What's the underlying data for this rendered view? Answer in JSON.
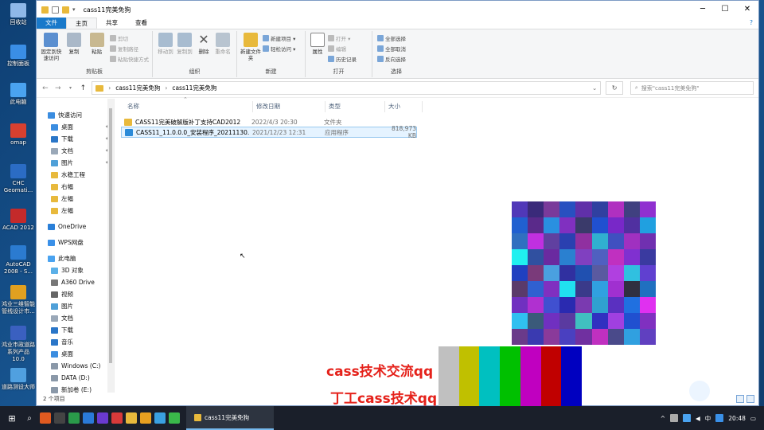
{
  "desktop": {
    "icons": [
      {
        "label": "回收站",
        "icon": "recycle-bin-icon",
        "color": "#8fb8e8"
      },
      {
        "label": "控制面板",
        "icon": "control-panel-icon",
        "color": "#3a8ee6"
      },
      {
        "label": "此电脑",
        "icon": "computer-icon",
        "color": "#4aa3f0"
      },
      {
        "label": "omap",
        "icon": "omap-icon",
        "color": "#d84030"
      },
      {
        "label": "CHC Geomati...",
        "icon": "chc-icon",
        "color": "#2b6cc4"
      },
      {
        "label": "ACAD 2012",
        "icon": "acad-icon",
        "color": "#c42a2a"
      },
      {
        "label": "AutoCAD 2008 - S...",
        "icon": "autocad-icon",
        "color": "#2b7bd0"
      },
      {
        "label": "鸿业三维智能管线设计市...",
        "icon": "hongye-pipe-icon",
        "color": "#e0a020"
      },
      {
        "label": "鸿业市政道路系列产品10.0",
        "icon": "hongye-road-icon",
        "color": "#3a60c0"
      },
      {
        "label": "道路测设大师",
        "icon": "road-survey-icon",
        "color": "#50a0e0"
      }
    ]
  },
  "window": {
    "title": "cass11完美免狗",
    "controls": {
      "minimize": "─",
      "maximize": "☐",
      "close": "✕"
    }
  },
  "ribbon_tabs": [
    "文件",
    "主页",
    "共享",
    "查看"
  ],
  "ribbon": {
    "clipboard": {
      "pin": "固定到快速访问",
      "copy": "复制",
      "paste": "粘贴",
      "cut": "剪切",
      "copy_path": "复制路径",
      "paste_shortcut": "粘贴快捷方式",
      "label": "剪贴板"
    },
    "organize": {
      "move_to": "移动到",
      "copy_to": "复制到",
      "delete": "删除",
      "rename": "重命名",
      "label": "组织"
    },
    "new": {
      "new_folder": "新建文件夹",
      "new_item": "新建项目 ▾",
      "easy_access": "轻松访问 ▾",
      "label": "新建"
    },
    "open": {
      "properties": "属性",
      "open": "打开 ▾",
      "edit": "编辑",
      "history": "历史记录",
      "label": "打开"
    },
    "select": {
      "select_all": "全部选择",
      "select_none": "全部取消",
      "invert": "反向选择",
      "label": "选择"
    }
  },
  "address": {
    "path": [
      "cass11完美免狗",
      "cass11完美免狗"
    ],
    "search_placeholder": "搜索\"cass11完美免狗\""
  },
  "sidebar": {
    "items": [
      {
        "label": "快速访问",
        "icon": "star-icon",
        "color": "#3b8de0",
        "pinned": false,
        "indent": 1
      },
      {
        "label": "桌面",
        "icon": "desktop-folder-icon",
        "color": "#3b8de0",
        "pinned": true,
        "indent": 2
      },
      {
        "label": "下载",
        "icon": "download-icon",
        "color": "#2a76c8",
        "pinned": true,
        "indent": 2
      },
      {
        "label": "文档",
        "icon": "documents-icon",
        "color": "#9aa8b8",
        "pinned": true,
        "indent": 2
      },
      {
        "label": "图片",
        "icon": "pictures-icon",
        "color": "#4fa0d8",
        "pinned": true,
        "indent": 2
      },
      {
        "label": "水稳工程",
        "icon": "folder-icon",
        "color": "#e8b93c",
        "pinned": false,
        "indent": 2
      },
      {
        "label": "右幅",
        "icon": "folder-icon",
        "color": "#e8b93c",
        "pinned": false,
        "indent": 2
      },
      {
        "label": "左幅",
        "icon": "folder-icon",
        "color": "#e8b93c",
        "pinned": false,
        "indent": 2
      },
      {
        "label": "左幅",
        "icon": "folder-icon",
        "color": "#e8b93c",
        "pinned": false,
        "indent": 2
      },
      {
        "label": "",
        "icon": "",
        "color": "",
        "pinned": false,
        "indent": 0
      },
      {
        "label": "OneDrive",
        "icon": "cloud-icon",
        "color": "#2a7fd8",
        "pinned": false,
        "indent": 1
      },
      {
        "label": "",
        "icon": "",
        "color": "",
        "pinned": false,
        "indent": 0
      },
      {
        "label": "WPS网盘",
        "icon": "wps-cloud-icon",
        "color": "#3a90e8",
        "pinned": false,
        "indent": 1
      },
      {
        "label": "",
        "icon": "",
        "color": "",
        "pinned": false,
        "indent": 0
      },
      {
        "label": "此电脑",
        "icon": "computer-icon",
        "color": "#4aa3f0",
        "pinned": false,
        "indent": 1
      },
      {
        "label": "3D 对象",
        "icon": "3d-objects-icon",
        "color": "#5bb0e8",
        "pinned": false,
        "indent": 2
      },
      {
        "label": "A360 Drive",
        "icon": "a360-icon",
        "color": "#777777",
        "pinned": false,
        "indent": 2
      },
      {
        "label": "视频",
        "icon": "video-icon",
        "color": "#666666",
        "pinned": false,
        "indent": 2
      },
      {
        "label": "图片",
        "icon": "pictures-icon",
        "color": "#4fa0d8",
        "pinned": false,
        "indent": 2
      },
      {
        "label": "文档",
        "icon": "documents-icon",
        "color": "#9aa8b8",
        "pinned": false,
        "indent": 2
      },
      {
        "label": "下载",
        "icon": "download-icon",
        "color": "#2a76c8",
        "pinned": false,
        "indent": 2
      },
      {
        "label": "音乐",
        "icon": "music-icon",
        "color": "#2a76c8",
        "pinned": false,
        "indent": 2
      },
      {
        "label": "桌面",
        "icon": "desktop-folder-icon",
        "color": "#3b8de0",
        "pinned": false,
        "indent": 2
      },
      {
        "label": "Windows (C:)",
        "icon": "drive-icon",
        "color": "#8a98a8",
        "pinned": false,
        "indent": 2
      },
      {
        "label": "DATA (D:)",
        "icon": "drive-icon",
        "color": "#8a98a8",
        "pinned": false,
        "indent": 2
      },
      {
        "label": "新加卷 (E:)",
        "icon": "drive-icon",
        "color": "#8a98a8",
        "pinned": false,
        "indent": 2
      }
    ]
  },
  "columns": [
    "名称",
    "修改日期",
    "类型",
    "大小"
  ],
  "files": [
    {
      "name": "CASS11完美破解版补丁支持CAD2012",
      "date": "2022/4/3 20:30",
      "type": "文件夹",
      "size": "",
      "icon": "folder-icon",
      "color": "#e8b93c",
      "selected": false
    },
    {
      "name": "CASS11_11.0.0.0_安装程序_20211130...",
      "date": "2021/12/23 12:31",
      "type": "应用程序",
      "size": "818,973 KB",
      "icon": "installer-icon",
      "color": "#2a8ad8",
      "selected": true
    }
  ],
  "status": {
    "count": "2 个项目"
  },
  "overlay": {
    "caption1": "cass技术交流qq",
    "caption2": "丁工cass技术qq",
    "bar_colors": [
      "#c0c0c0",
      "#c0c000",
      "#00c0c0",
      "#00c000",
      "#c000c0",
      "#c00000",
      "#0000c0"
    ],
    "mosaic_colors": [
      "#5038b8",
      "#3a2a7a",
      "#7a3a9a",
      "#2850c0",
      "#6030a8",
      "#3040a0",
      "#b030c0",
      "#404080",
      "#9030d0",
      "#2060d0",
      "#5a2a8a",
      "#2a90e0",
      "#8030c0",
      "#3a3a6a",
      "#2050d0",
      "#7828c8",
      "#5030a0",
      "#20a0e0",
      "#3070c0",
      "#c030e0",
      "#6040a0",
      "#2a40b0",
      "#9030a0",
      "#30b0d0",
      "#4050c0",
      "#a030c0",
      "#7030b0",
      "#20f0f0",
      "#3050a0",
      "#6a2aa0",
      "#2a80d0",
      "#8040c0",
      "#5060c0",
      "#c030c0",
      "#8030d0",
      "#3a3aa0",
      "#2040c0",
      "#7a3a7a",
      "#4aa0e0",
      "#3030a0",
      "#2050b0",
      "#5a5aa0",
      "#b040e0",
      "#30c0e0",
      "#6040d0",
      "#5a3a6a",
      "#3060d0",
      "#8030c0",
      "#20e0f0",
      "#3a3a8a",
      "#30a0e0",
      "#a030d0",
      "#303040",
      "#2070c0",
      "#7030c0",
      "#b030d0",
      "#4050d0",
      "#2a2ab0",
      "#7a3ab0",
      "#30a0d0",
      "#5a30c0",
      "#2070e0",
      "#e030f0",
      "#30c0f0",
      "#3a5a7a",
      "#7030c0",
      "#5a3aa0",
      "#40c0c0",
      "#3030c0",
      "#a040e0",
      "#2050d0",
      "#8030c0",
      "#6a3a8a",
      "#3a3ab0",
      "#8a3a9a",
      "#4a40c0",
      "#7030a0",
      "#c030c0",
      "#4a4a8a",
      "#30a0e0",
      "#6040c0"
    ]
  }
}
